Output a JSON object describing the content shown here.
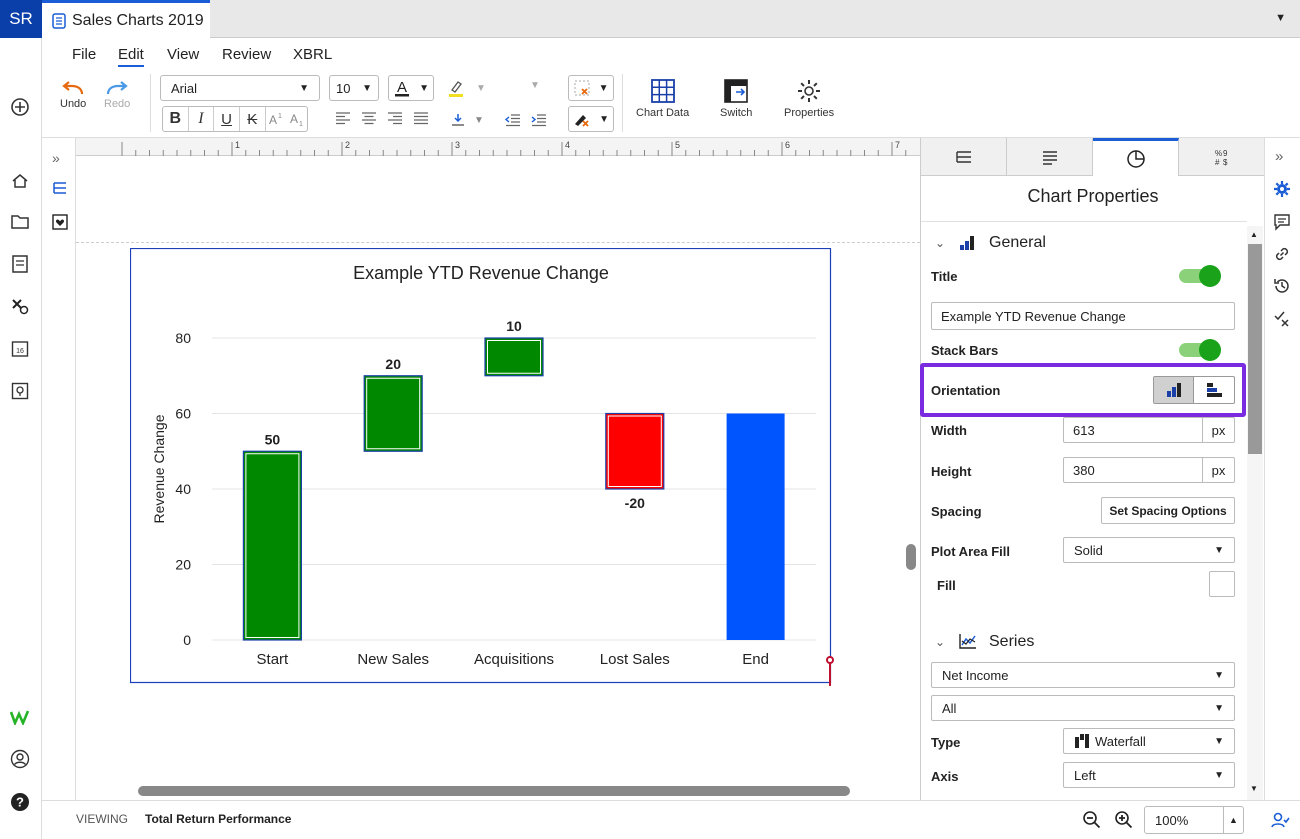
{
  "app": {
    "logo": "SR",
    "doc_title": "Sales Charts 2019"
  },
  "menu": [
    "File",
    "Edit",
    "View",
    "Review",
    "XBRL"
  ],
  "toolbar": {
    "undo": "Undo",
    "redo": "Redo",
    "font_name": "Arial",
    "font_size": "10",
    "bold": "B",
    "italic": "I",
    "underline": "U",
    "strike": "K",
    "chart_data": "Chart Data",
    "switch": "Switch",
    "properties": "Properties"
  },
  "ruler": [
    "1",
    "2",
    "3",
    "4",
    "5",
    "6",
    "7"
  ],
  "panel": {
    "title": "Chart Properties",
    "general": "General",
    "title_label": "Title",
    "title_value": "Example YTD Revenue Change",
    "stack_bars": "Stack Bars",
    "orientation": "Orientation",
    "width_label": "Width",
    "width_value": "613",
    "width_unit": "px",
    "height_label": "Height",
    "height_value": "380",
    "height_unit": "px",
    "spacing_label": "Spacing",
    "spacing_button": "Set Spacing Options",
    "plot_fill_label": "Plot Area Fill",
    "plot_fill_value": "Solid",
    "fill_label": "Fill",
    "series": "Series",
    "series_select": "Net Income",
    "series_filter": "All",
    "type_label": "Type",
    "type_value": "Waterfall",
    "axis_label": "Axis",
    "axis_value": "Left"
  },
  "status": {
    "viewing": "VIEWING",
    "doc": "Total Return Performance",
    "zoom": "100%"
  },
  "colors": {
    "accent": "#1a5dd6",
    "positive": "#008800",
    "negative": "#ff0000",
    "total": "#0055ff",
    "highlight": "#7a2be0"
  },
  "chart_data": {
    "type": "bar",
    "subtype": "waterfall",
    "title": "Example YTD Revenue Change",
    "xlabel": "",
    "ylabel": "Revenue Change",
    "categories": [
      "Start",
      "New Sales",
      "Acquisitions",
      "Lost Sales",
      "End"
    ],
    "values": [
      50,
      20,
      10,
      -20,
      60
    ],
    "bases": [
      0,
      50,
      70,
      60,
      0
    ],
    "labels": [
      "50",
      "20",
      "10",
      "-20",
      ""
    ],
    "yticks": [
      "0",
      "20",
      "40",
      "60",
      "80"
    ],
    "ylim": [
      0,
      80
    ],
    "grid": true
  }
}
